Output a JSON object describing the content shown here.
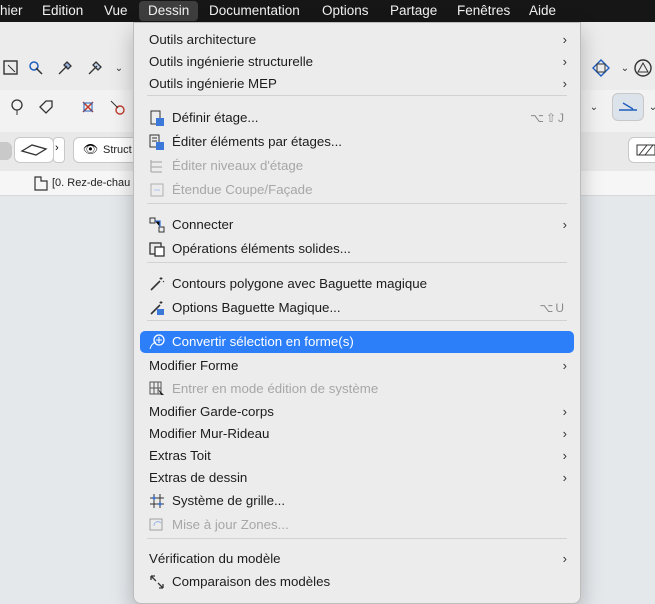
{
  "menubar": {
    "items": [
      "hier",
      "Edition",
      "Vue",
      "Dessin",
      "Documentation",
      "Options",
      "Partage",
      "Fenêtres",
      "Aide"
    ],
    "active": "Dessin"
  },
  "background": {
    "struct_label": "Struct",
    "story_label": "[0. Rez-de-chau"
  },
  "menu": {
    "items": [
      {
        "label": "Outils architecture",
        "submenu": true
      },
      {
        "label": "Outils ingénierie structurelle",
        "submenu": true
      },
      {
        "label": "Outils ingénierie MEP",
        "submenu": true
      },
      {
        "label": "Définir étage...",
        "shortcut": "⌥⇧J",
        "icon": "define-story-icon"
      },
      {
        "label": "Éditer éléments par étages...",
        "icon": "edit-elements-stories-icon"
      },
      {
        "label": "Éditer niveaux d'étage",
        "disabled": true,
        "icon": "edit-story-levels-icon"
      },
      {
        "label": "Étendue Coupe/Façade",
        "disabled": true,
        "icon": "section-extent-icon"
      },
      {
        "label": "Connecter",
        "submenu": true,
        "icon": "connect-icon"
      },
      {
        "label": "Opérations éléments solides...",
        "icon": "solid-operations-icon"
      },
      {
        "label": "Contours polygone avec Baguette magique",
        "icon": "magic-wand-icon"
      },
      {
        "label": "Options Baguette Magique...",
        "shortcut": "⌥U",
        "icon": "magic-wand-options-icon"
      },
      {
        "label": "Convertir sélection en forme(s)",
        "selected": true,
        "icon": "convert-shape-icon"
      },
      {
        "label": "Modifier Forme",
        "submenu": true
      },
      {
        "label": "Entrer en mode édition de système",
        "disabled": true,
        "icon": "system-edit-icon"
      },
      {
        "label": "Modifier Garde-corps",
        "submenu": true
      },
      {
        "label": "Modifier Mur-Rideau",
        "submenu": true
      },
      {
        "label": "Extras Toit",
        "submenu": true
      },
      {
        "label": "Extras de dessin",
        "submenu": true
      },
      {
        "label": "Système de grille...",
        "icon": "grid-system-icon"
      },
      {
        "label": "Mise à jour Zones...",
        "disabled": true,
        "icon": "update-zones-icon"
      },
      {
        "label": "Vérification du modèle",
        "submenu": true
      },
      {
        "label": "Comparaison des modèles",
        "icon": "model-compare-icon"
      }
    ]
  },
  "colors": {
    "selection": "#2d7ff9",
    "menubar": "#161616"
  }
}
